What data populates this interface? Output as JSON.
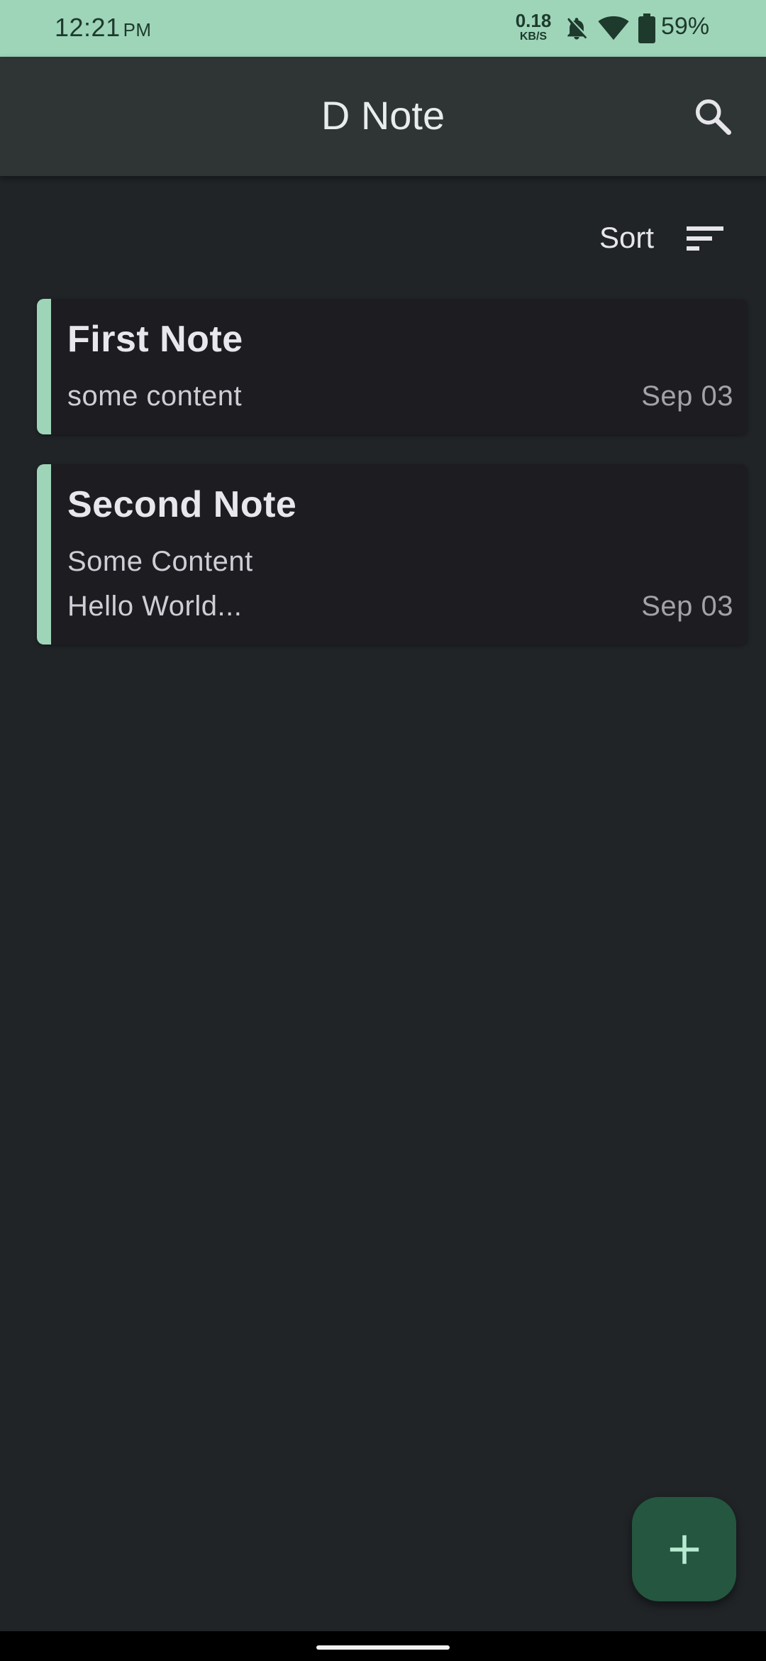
{
  "status_bar": {
    "time": "12:21",
    "ampm": "PM",
    "net_speed_value": "0.18",
    "net_speed_unit": "KB/S",
    "battery": "59%",
    "icons": [
      "bell-off-icon",
      "wifi-icon",
      "battery-icon"
    ]
  },
  "app_bar": {
    "title": "D Note",
    "search_icon": "search-icon"
  },
  "sort": {
    "label": "Sort",
    "icon": "sort-icon"
  },
  "notes": [
    {
      "title": "First Note",
      "lines": [
        "some content"
      ],
      "date": "Sep 03"
    },
    {
      "title": "Second Note",
      "lines": [
        "Some Content",
        "Hello World..."
      ],
      "date": "Sep 03"
    }
  ],
  "fab": {
    "icon": "plus-icon"
  },
  "colors": {
    "accent": "#9ed5b9",
    "background": "#202427",
    "app_bar": "#2e3534",
    "card": "#1d1d21",
    "fab": "#255640"
  }
}
